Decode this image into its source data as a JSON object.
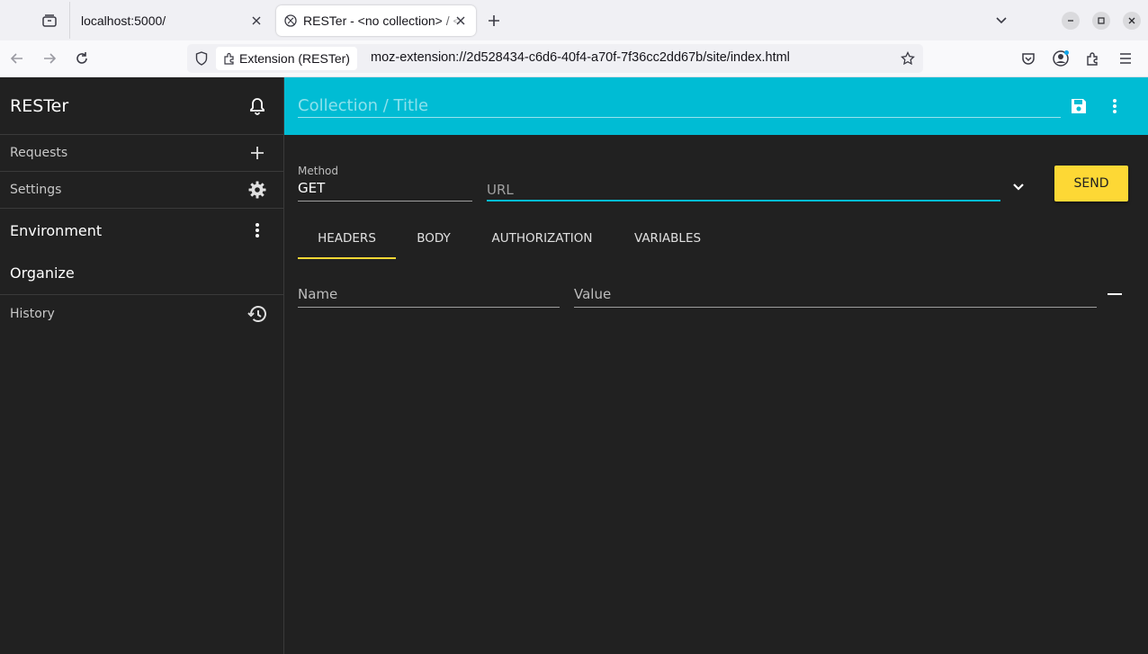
{
  "browser": {
    "tabs": [
      {
        "title": "localhost:5000/"
      },
      {
        "title": "RESTer - <no collection> / <untitled>"
      }
    ],
    "identity_label": "Extension (RESTer)",
    "address": "moz-extension://2d528434-c6d6-40f4-a70f-7f36cc2dd67b/site/index.html"
  },
  "sidebar": {
    "title": "RESTer",
    "items": [
      {
        "label": "Requests",
        "icon": "plus-icon"
      },
      {
        "label": "Settings",
        "icon": "gear-icon"
      },
      {
        "label": "Environment",
        "icon": "more-vert-icon"
      },
      {
        "label": "Organize"
      },
      {
        "label": "History",
        "icon": "history-icon"
      }
    ]
  },
  "request": {
    "title_placeholder": "Collection / Title",
    "method_label": "Method",
    "method": "GET",
    "url_placeholder": "URL",
    "send_label": "SEND",
    "tabs": [
      "HEADERS",
      "BODY",
      "AUTHORIZATION",
      "VARIABLES"
    ],
    "active_tab": "HEADERS",
    "header_name_placeholder": "Name",
    "header_value_placeholder": "Value"
  },
  "colors": {
    "accent": "#00bcd4",
    "send": "#fdd835",
    "background": "#212121"
  }
}
